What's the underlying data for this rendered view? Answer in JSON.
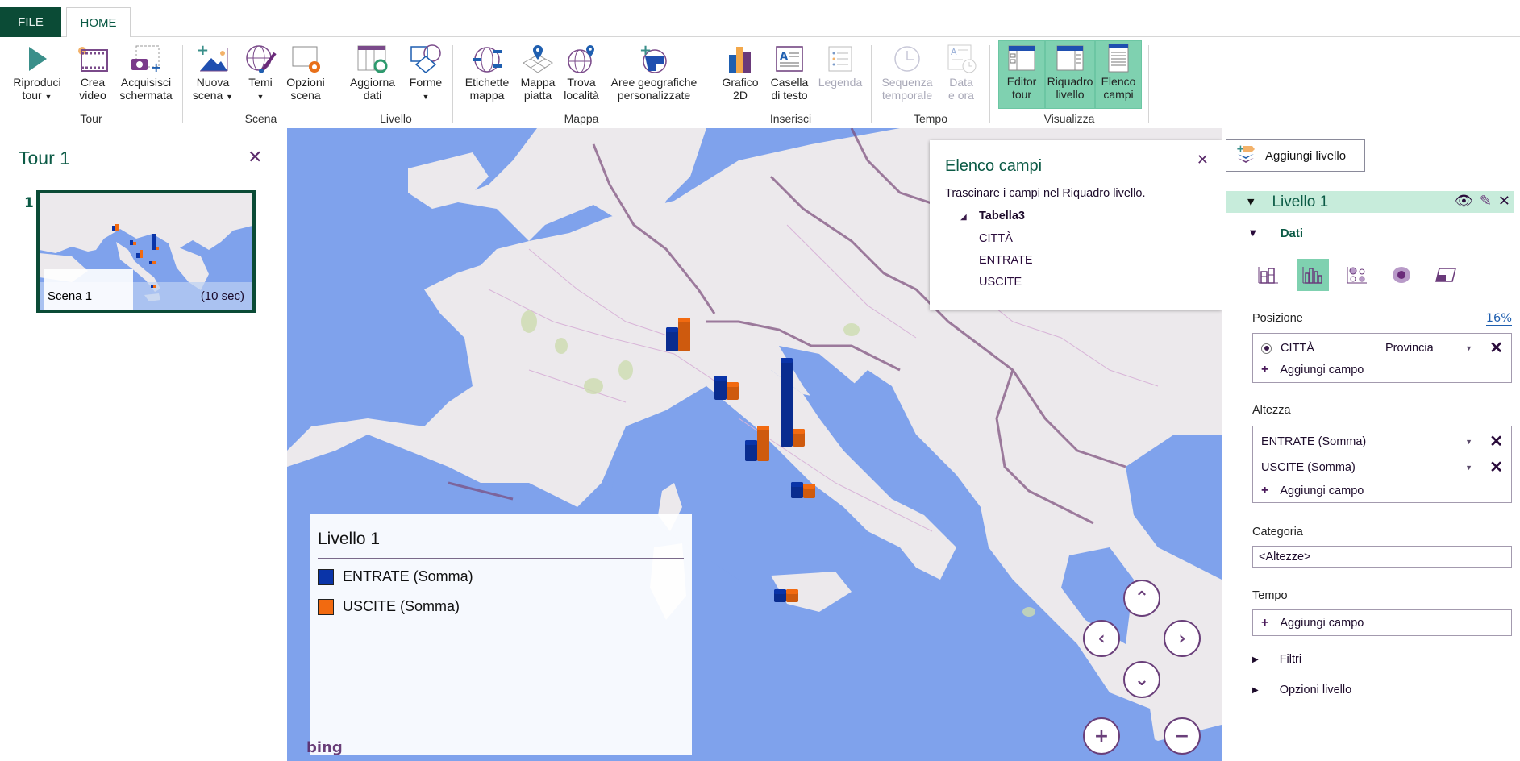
{
  "tabs": {
    "file": "FILE",
    "home": "HOME"
  },
  "ribbon": {
    "groups": {
      "tour": "Tour",
      "scena": "Scena",
      "livello": "Livello",
      "mappa": "Mappa",
      "inserisci": "Inserisci",
      "tempo": "Tempo",
      "visualizza": "Visualizza"
    },
    "buttons": {
      "riproduci": [
        "Riproduci",
        "tour"
      ],
      "crea_video": [
        "Crea",
        "video"
      ],
      "acquisisci": [
        "Acquisisci",
        "schermata"
      ],
      "nuova_scena": [
        "Nuova",
        "scena"
      ],
      "temi": [
        "Temi",
        ""
      ],
      "opzioni_scena": [
        "Opzioni",
        "scena"
      ],
      "aggiorna": [
        "Aggiorna",
        "dati"
      ],
      "forme": [
        "Forme",
        ""
      ],
      "etichette": [
        "Etichette",
        "mappa"
      ],
      "mappa_piatta": [
        "Mappa",
        "piatta"
      ],
      "trova": [
        "Trova",
        "località"
      ],
      "aree": [
        "Aree geografiche",
        "personalizzate"
      ],
      "grafico": [
        "Grafico",
        "2D"
      ],
      "casella": [
        "Casella",
        "di testo"
      ],
      "legenda": [
        "Legenda",
        ""
      ],
      "sequenza": [
        "Sequenza",
        "temporale"
      ],
      "data_ora": [
        "Data",
        "e ora"
      ],
      "editor_tour": [
        "Editor",
        "tour"
      ],
      "riquadro_livello": [
        "Riquadro",
        "livello"
      ],
      "elenco_campi": [
        "Elenco",
        "campi"
      ]
    }
  },
  "tour_panel": {
    "title": "Tour 1",
    "scenes": [
      {
        "number": "1",
        "name": "Scena 1",
        "duration": "(10 sec)"
      }
    ]
  },
  "map": {
    "legend": {
      "title": "Livello 1",
      "items": [
        {
          "label": "ENTRATE (Somma)",
          "color": "#0a34a8"
        },
        {
          "label": "USCITE (Somma)",
          "color": "#f26a10"
        }
      ]
    },
    "attribution": "bing",
    "nav": {
      "up": "⌃",
      "down": "⌄",
      "left": "‹",
      "right": "›",
      "zoom_in": "+",
      "zoom_out": "−"
    },
    "series_colors": {
      "entrate": "#0a34a8",
      "uscite": "#f26a10"
    }
  },
  "field_list": {
    "title": "Elenco campi",
    "hint": "Trascinare i campi nel Riquadro livello.",
    "table": "Tabella3",
    "fields": [
      "CITTÀ",
      "ENTRATE",
      "USCITE"
    ]
  },
  "layer_pane": {
    "add_layer": "Aggiungi livello",
    "layer_name": "Livello 1",
    "dati": "Dati",
    "posizione": {
      "label": "Posizione",
      "percent": "16%",
      "field": "CITTÀ",
      "geo_type": "Provincia",
      "add_field": "Aggiungi campo"
    },
    "altezza": {
      "label": "Altezza",
      "fields": [
        "ENTRATE (Somma)",
        "USCITE (Somma)"
      ],
      "add_field": "Aggiungi campo"
    },
    "categoria": {
      "label": "Categoria",
      "value": "<Altezze>"
    },
    "tempo": {
      "label": "Tempo",
      "add_field": "Aggiungi campo"
    },
    "filtri": "Filtri",
    "opzioni_livello": "Opzioni livello"
  }
}
